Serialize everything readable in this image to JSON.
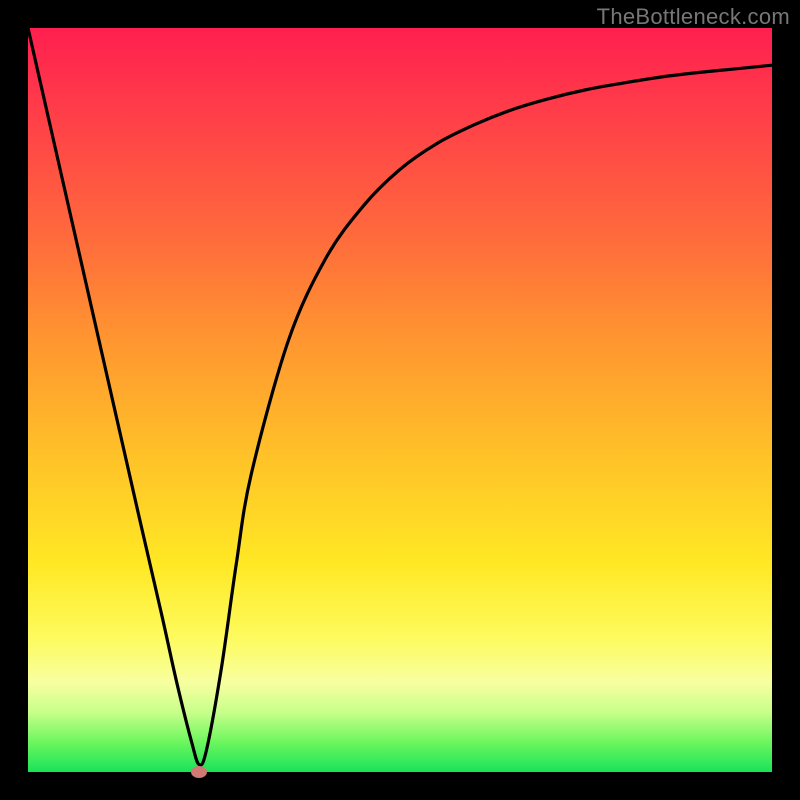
{
  "watermark": "TheBottleneck.com",
  "colors": {
    "frame": "#000000",
    "gradient_top": "#ff1f4f",
    "gradient_bottom": "#18e35a",
    "curve": "#000000",
    "marker": "#cf7a73"
  },
  "chart_data": {
    "type": "line",
    "title": "",
    "xlabel": "",
    "ylabel": "",
    "xlim": [
      0,
      100
    ],
    "ylim": [
      0,
      100
    ],
    "grid": false,
    "legend": false,
    "series": [
      {
        "name": "curve",
        "x": [
          0,
          5,
          10,
          15,
          18,
          20,
          22,
          23,
          24,
          26,
          28,
          30,
          35,
          40,
          45,
          50,
          55,
          60,
          65,
          70,
          75,
          80,
          85,
          90,
          95,
          100
        ],
        "values": [
          100,
          78,
          56,
          34,
          21,
          12,
          4,
          1,
          3,
          14,
          28,
          40,
          58,
          69,
          76,
          81,
          84.5,
          87,
          89,
          90.5,
          91.7,
          92.6,
          93.4,
          94,
          94.5,
          95
        ]
      }
    ],
    "marker": {
      "x": 23,
      "y": 0
    },
    "annotations": []
  }
}
